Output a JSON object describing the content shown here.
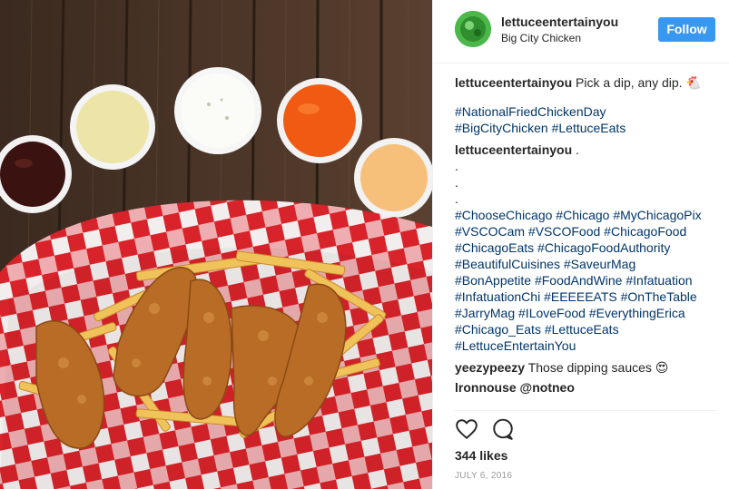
{
  "photo": {
    "subject": "basket of fried chicken tenders and fries with five dipping sauces"
  },
  "header": {
    "username": "lettuceentertainyou",
    "location": "Big City Chicken",
    "follow_label": "Follow"
  },
  "caption": {
    "username": "lettuceentertainyou",
    "text": "Pick a dip, any dip. 🐔",
    "hashtags_1": [
      "#NationalFriedChickenDay",
      "#BigCityChicken #LettuceEats"
    ]
  },
  "comment1": {
    "username": "lettuceentertainyou",
    "text": ".",
    "dots": [
      ".",
      ".",
      "."
    ],
    "hashtags": [
      "#ChooseChicago #Chicago #MyChicagoPix",
      "#VSCOCam #VSCOFood #ChicagoFood",
      "#ChicagoEats #ChicagoFoodAuthority",
      "#BeautifulCuisines #SaveurMag",
      "#BonAppetite #FoodAndWine #Infatuation",
      "#InfatuationChi #EEEEEATS #OnTheTable",
      "#JarryMag #ILoveFood #EverythingErica",
      "#Chicago_Eats #LettuceEats",
      "#LettuceEntertainYou"
    ]
  },
  "comment2": {
    "username": "yeezypeezy",
    "text": "Those dipping sauces 😍"
  },
  "comment3": {
    "username_partial": "lronnouse @notneo"
  },
  "actions": {
    "like_icon": "heart-icon",
    "comment_icon": "comment-icon"
  },
  "likes": "344 likes",
  "date": "JULY 6, 2016",
  "colors": {
    "follow": "#3897f0",
    "hashtag": "#003569",
    "checker_red": "#d8232a",
    "wood": "#4a3526"
  }
}
